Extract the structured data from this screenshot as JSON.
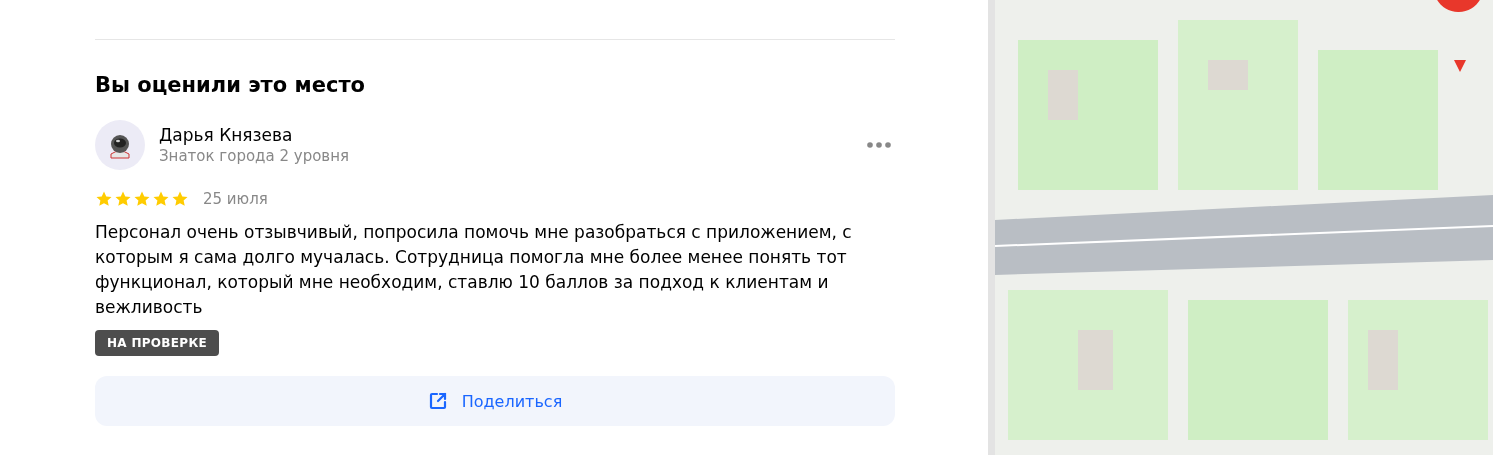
{
  "section": {
    "title": "Вы оценили это место"
  },
  "review": {
    "author": "Дарья Князева",
    "author_level": "Знаток города 2 уровня",
    "stars": 5,
    "date": "25 июля",
    "text": "Персонал очень отзывчивый, попросила помочь мне разобраться с приложением, с которым я сама долго мучалась. Сотрудница помогла мне более менее понять тот функционал, который мне необходим, ставлю 10 баллов за подход к клиентам и вежливость",
    "status": "НА ПРОВЕРКЕ"
  },
  "share_button": {
    "label": "Поделиться"
  }
}
